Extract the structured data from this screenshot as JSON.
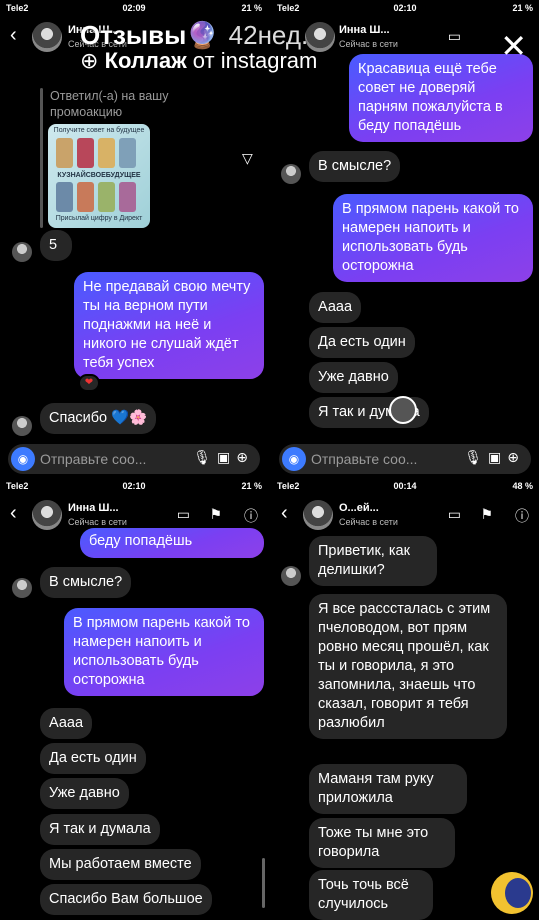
{
  "status": {
    "carrier": "Tele2",
    "time1": "02:09",
    "time2": "02:10",
    "time3": "02:10",
    "time4": "00:14",
    "battery1": "21 %",
    "battery2": "21 %",
    "battery3": "21 %",
    "battery4": "48 %"
  },
  "chat": {
    "name": "Инна Ш...",
    "name_full": "Инна Ш...",
    "name4": "О...ей...",
    "subtitle": "Сейчас в сети"
  },
  "overlay": {
    "title": "Отзывы",
    "time_ago": "42нед.",
    "subtitle_bold": "Коллаж",
    "subtitle_rest": "от instagram"
  },
  "promo": {
    "replied_label": "Ответил(-а) на вашу промоакцию",
    "top": "Получите совет на будущее",
    "mid": "КУЗНАЙСВОЕБУДУЩЕЕ",
    "bottom": "Присылай цифру в Директ"
  },
  "p1": {
    "msg_5": "5",
    "out_1": "Не предавай свою мечту ты на верном пути поднажми на неё и никого не слушай ждёт тебя успех",
    "in_thanks": "Спасибо 💙🌸"
  },
  "p2": {
    "out_top": "Красавица ещё тебе совет не доверяй парням пожалуйста в беду попадёшь",
    "in_1": "В смысле?",
    "out_2": "В прямом парень какой то намерен напоить и использовать будь осторожна",
    "in_2": "Аааа",
    "in_3": "Да есть один",
    "in_4": "Уже давно",
    "in_5": "Я так и думала"
  },
  "p3": {
    "out_top": "беду попадёшь",
    "in_1": "В смысле?",
    "out_2": "В прямом парень какой то намерен напоить и использовать будь осторожна",
    "in_2": "Аааа",
    "in_3": "Да есть один",
    "in_4": "Уже давно",
    "in_5": "Я так и думала",
    "in_6": "Мы работаем вместе",
    "in_7": "Спасибо Вам большое"
  },
  "p4": {
    "in_1": "Приветик, как делишки?",
    "in_2": "Я все расссталась с этим пчеловодом, вот прям ровно месяц прошёл, как ты и говорила, я это запомнила, знаешь что сказал, говорит я тебя разлюбил",
    "in_3": "Маманя там руку приложила",
    "in_4": "Тоже ты мне это говорила",
    "in_5": "Точь точь всё случилось"
  },
  "composer": {
    "placeholder": "Отправьте соо..."
  },
  "colors": {
    "accent": "#3d7bff",
    "bubble_in": "#262626",
    "bubble_out_start": "#4a5bff",
    "bubble_out_end": "#8d40e8"
  }
}
